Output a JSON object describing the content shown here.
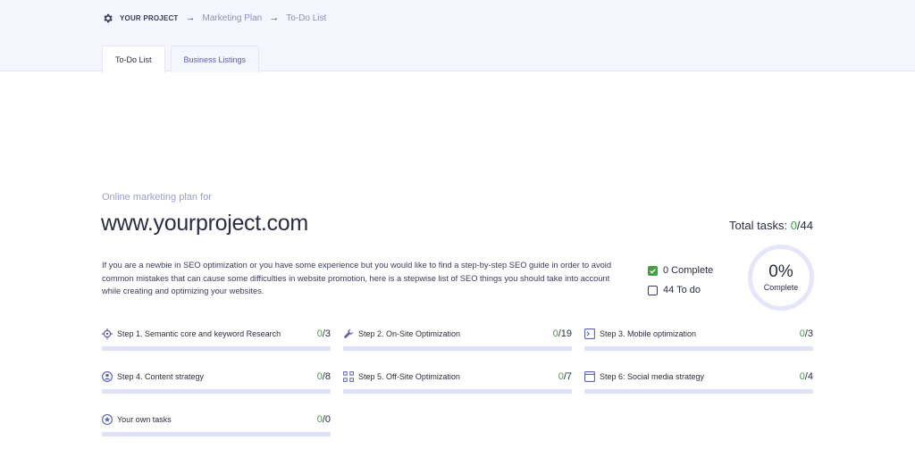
{
  "breadcrumb": {
    "root": "YOUR PROJECT",
    "items": [
      "Marketing Plan",
      "To-Do List"
    ],
    "arrow": "→"
  },
  "tabs": [
    {
      "label": "To-Do List",
      "active": true
    },
    {
      "label": "Business Listings",
      "active": false
    }
  ],
  "header": {
    "subtitle": "Online marketing plan for",
    "site": "www.yourproject.com",
    "total_label": "Total tasks: ",
    "total_done": "0",
    "total_all": "/44"
  },
  "description": "If you are a newbie in SEO optimization or you have some experience but you would like to find a step-by-step SEO guide in order to avoid common mistakes that can cause some difficulties in website promotion, here is a stepwise list of SEO things you should take into account while creating and optimizing your websites.",
  "legend": {
    "complete": "0 Complete",
    "todo": "44 To do"
  },
  "progress": {
    "percent_label": "0%",
    "caption": "Complete",
    "fraction": 0
  },
  "steps": [
    {
      "icon": "target-icon",
      "label": "Step 1. Semantic core and keyword Research",
      "done": "0",
      "total": "/3",
      "progress": 0
    },
    {
      "icon": "wrench-icon",
      "label": "Step 2. On-Site Optimization",
      "done": "0",
      "total": "/19",
      "progress": 0
    },
    {
      "icon": "terminal-icon",
      "label": "Step 3. Mobile optimization",
      "done": "0",
      "total": "/3",
      "progress": 0
    },
    {
      "icon": "user-circle-icon",
      "label": "Step 4. Content strategy",
      "done": "0",
      "total": "/8",
      "progress": 0
    },
    {
      "icon": "link-grid-icon",
      "label": "Step 5. Off-Site Optimization",
      "done": "0",
      "total": "/7",
      "progress": 0
    },
    {
      "icon": "browser-window-icon",
      "label": "Step 6: Social media strategy",
      "done": "0",
      "total": "/4",
      "progress": 0
    },
    {
      "icon": "star-circle-icon",
      "label": "Your own tasks",
      "done": "0",
      "total": "/0",
      "progress": 0
    }
  ],
  "colors": {
    "accent": "#5c62b0",
    "complete": "#41a33f",
    "track": "#e0e0f8",
    "header_bg": "#f5f5fd"
  }
}
